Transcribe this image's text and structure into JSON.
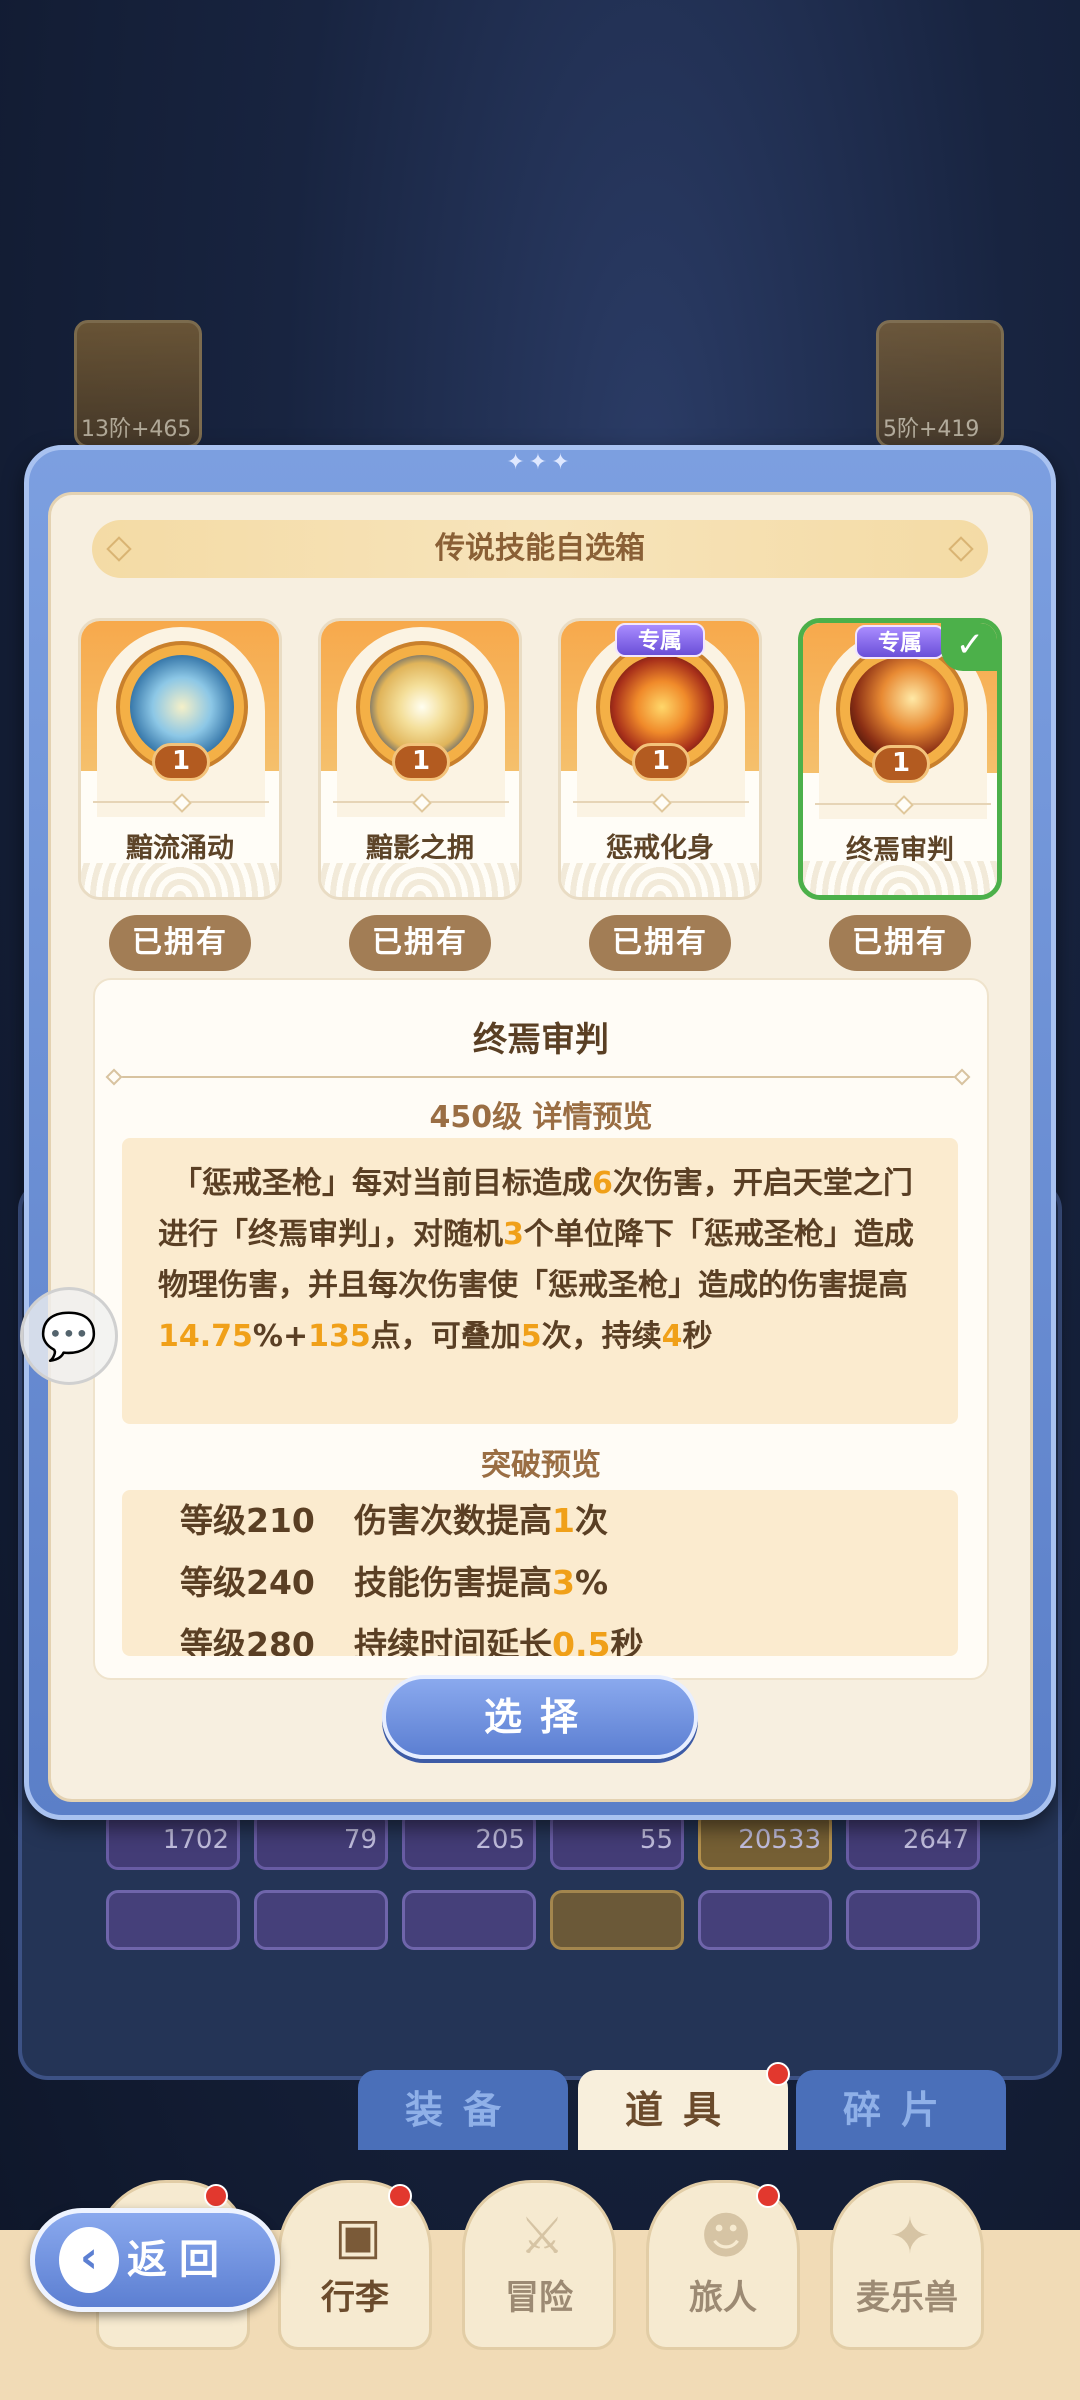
{
  "background": {
    "top_items": [
      {
        "label": "13阶+465"
      },
      {
        "label": "5阶+419"
      }
    ],
    "row_values": [
      "1702",
      "79",
      "205",
      "55",
      "20533",
      "2647"
    ]
  },
  "modal": {
    "title": "传说技能自选箱",
    "skills": [
      {
        "name": "黯流涌动",
        "level": "1",
        "owned": "已拥有",
        "exclusive": "",
        "selected": false
      },
      {
        "name": "黯影之拥",
        "level": "1",
        "owned": "已拥有",
        "exclusive": "",
        "selected": false
      },
      {
        "name": "惩戒化身",
        "level": "1",
        "owned": "已拥有",
        "exclusive": "专属",
        "selected": false
      },
      {
        "name": "终焉审判",
        "level": "1",
        "owned": "已拥有",
        "exclusive": "专属",
        "selected": true
      }
    ],
    "detail": {
      "name": "终焉审判",
      "preview_header": "450级  详情预览",
      "desc_parts": {
        "p1": "「惩戒圣枪」每对当前目标造成",
        "n1": "6",
        "p2": "次伤害，开启天堂之门进行「终焉审判」，对随机",
        "n2": "3",
        "p3": "个单位降下「惩戒圣枪」造成物理伤害，并且每次伤害使「惩戒圣枪」造成的伤害提高",
        "n3": "14.75",
        "p4": "%+",
        "n4": "135",
        "p5": "点，可叠加",
        "n5": "5",
        "p6": "次，持续",
        "n6": "4",
        "p7": "秒"
      },
      "break_header": "突破预览",
      "breakthroughs": [
        {
          "level": "等级210",
          "pre": "伤害次数提高",
          "value": "1",
          "post": "次"
        },
        {
          "level": "等级240",
          "pre": "技能伤害提高",
          "value": "3",
          "post": "%"
        },
        {
          "level": "等级280",
          "pre": "持续时间延长",
          "value": "0.5",
          "post": "秒"
        }
      ]
    },
    "select_label": "选择"
  },
  "tabs": {
    "equipment": "装备",
    "items": "道具",
    "fragments": "碎片"
  },
  "nav": {
    "back": "返回",
    "luggage": "行李",
    "adventure": "冒险",
    "traveler": "旅人",
    "pet": "麦乐兽"
  },
  "colors": {
    "highlight": "#f0a019",
    "select_green": "#4cb04a",
    "modal_blue": "#5b7fc8"
  }
}
